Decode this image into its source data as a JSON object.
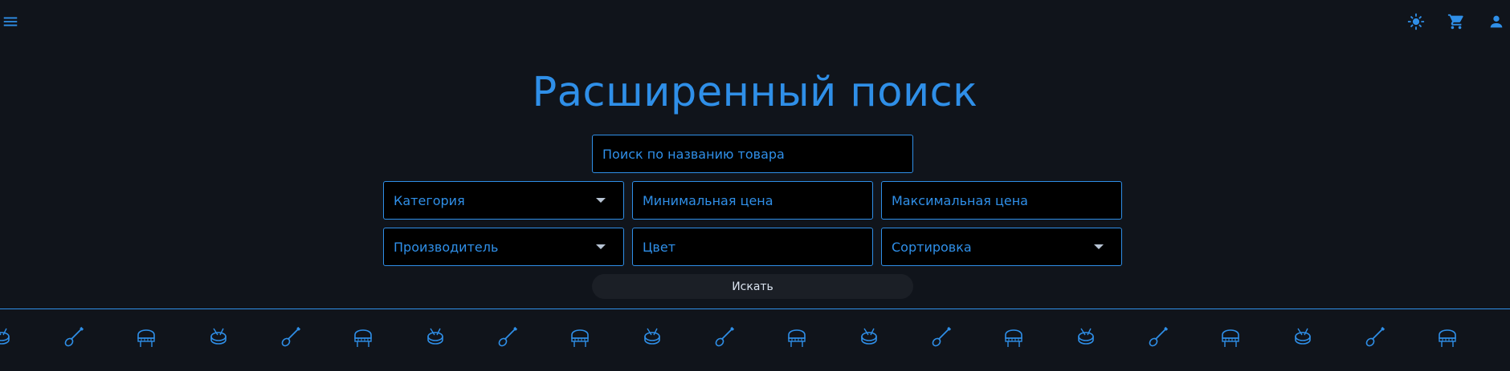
{
  "header": {
    "menu_icon": "menu-icon",
    "theme_icon": "sun-icon",
    "cart_icon": "cart-icon",
    "account_icon": "person-icon"
  },
  "main": {
    "title": "Расширенный поиск",
    "search_label": "Поиск по названию товара",
    "category_label": "Категория",
    "min_price_label": "Минимальная цена",
    "max_price_label": "Максимальная цена",
    "manufacturer_label": "Производитель",
    "color_label": "Цвет",
    "sort_label": "Сортировка",
    "search_button": "Искать"
  },
  "decor": {
    "pattern": [
      "drum-icon",
      "guitar-icon",
      "piano-icon"
    ],
    "accent_color": "#2f8fe8"
  }
}
